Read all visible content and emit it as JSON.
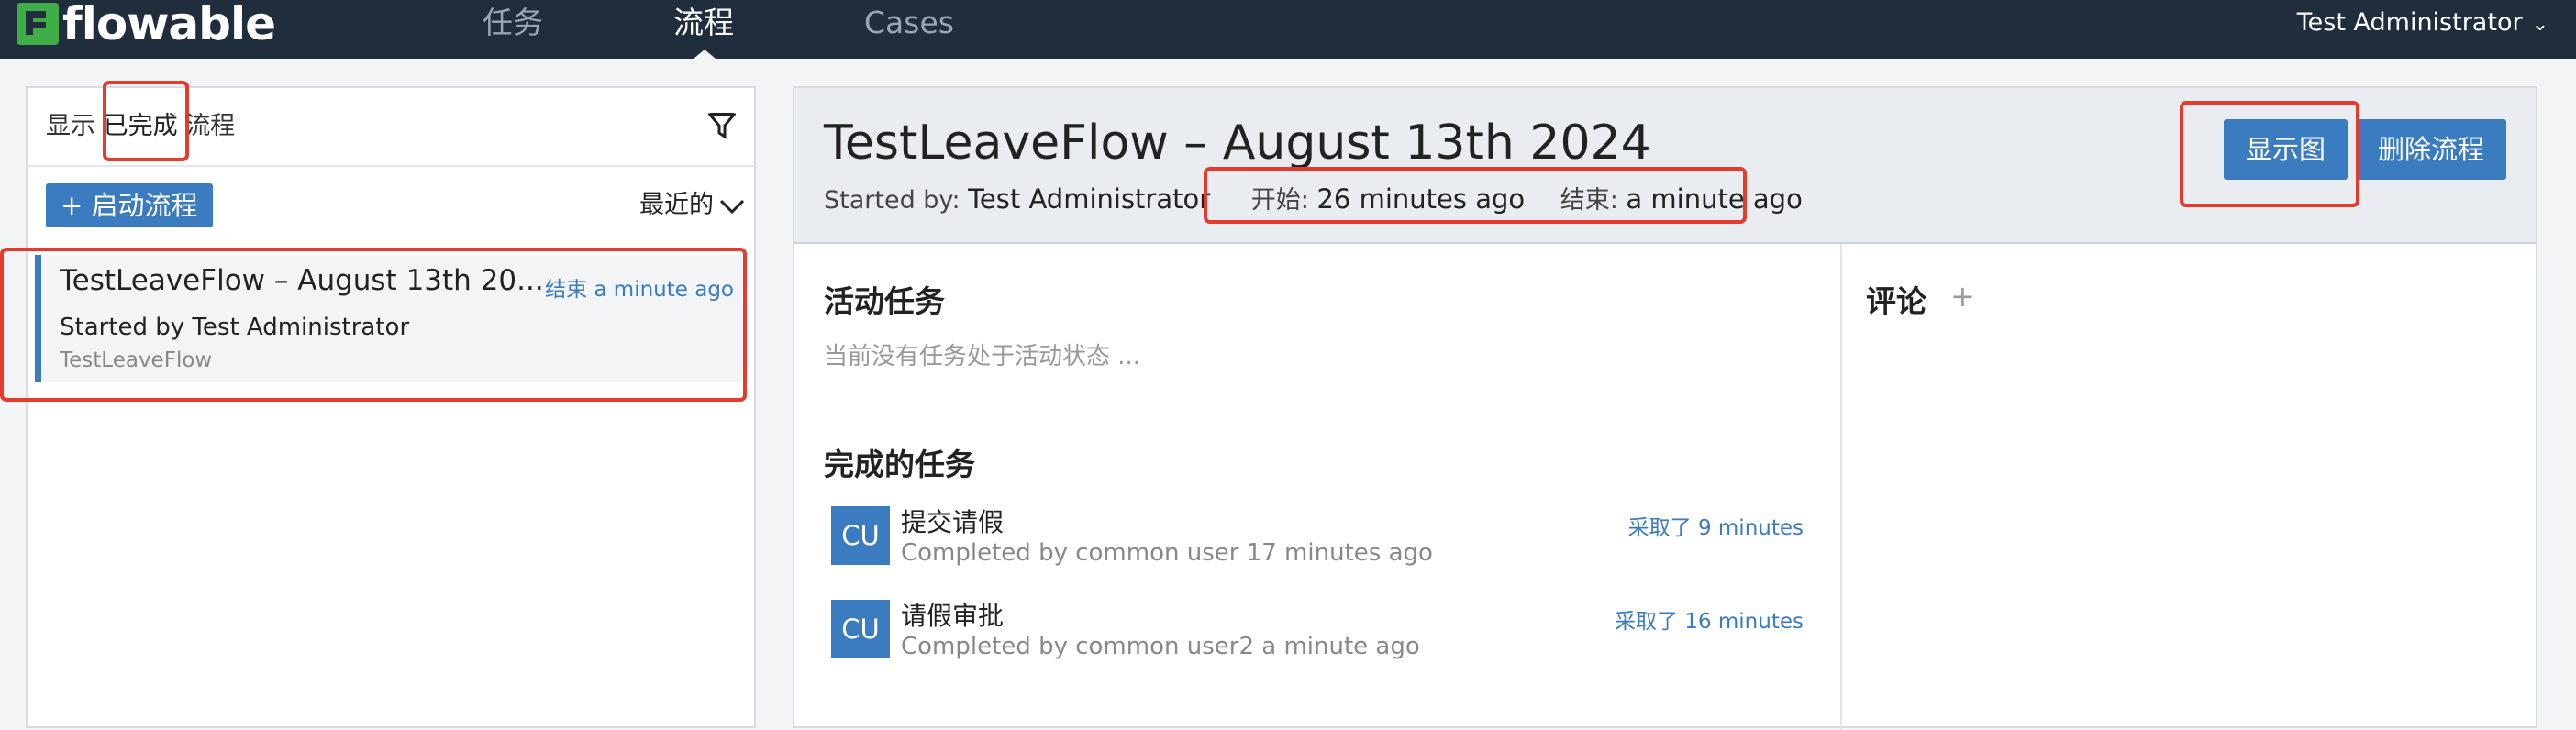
{
  "navbar": {
    "logo_text": "flowable",
    "nav_items": [
      "任务",
      "流程",
      "Cases"
    ],
    "active_item": "流程",
    "user_name": "Test Administrator",
    "user_chevron": "⌄"
  },
  "left_panel": {
    "filter": {
      "prefix": "显示",
      "state": "已完成",
      "suffix": "流程",
      "icon": "funnel-icon"
    },
    "start_button_label": "+ 启动流程",
    "sort_label": "最近的",
    "process_list": [
      {
        "title": "TestLeaveFlow – August 13th 20...",
        "ended_label": "结束",
        "ended_time": "a minute ago",
        "started_by": "Started by Test Administrator",
        "definition": "TestLeaveFlow"
      }
    ]
  },
  "detail": {
    "title": "TestLeaveFlow – August 13th 2024",
    "started_by_label": "Started by:",
    "started_by_value": "Test Administrator",
    "start_label": "开始:",
    "start_value": "26 minutes ago",
    "end_label": "结束:",
    "end_value": "a minute ago",
    "show_diagram_button": "显示图",
    "delete_button": "删除流程",
    "active_tasks_title": "活动任务",
    "active_tasks_empty": "当前没有任务处于活动状态 ...",
    "completed_tasks_title": "完成的任务",
    "completed_tasks": [
      {
        "avatar": "CU",
        "name": "提交请假",
        "completed_by": "Completed by common user 17 minutes ago",
        "duration": "采取了 9 minutes"
      },
      {
        "avatar": "CU",
        "name": "请假审批",
        "completed_by": "Completed by common user2 a minute ago",
        "duration": "采取了 16 minutes"
      }
    ],
    "comments_title": "评论",
    "comments_add": "+"
  },
  "colors": {
    "navbar_bg": "#1f2d3d",
    "accent": "#3b7bbf",
    "logo_green": "#3fae48",
    "annotation_red": "#e53b2c"
  }
}
